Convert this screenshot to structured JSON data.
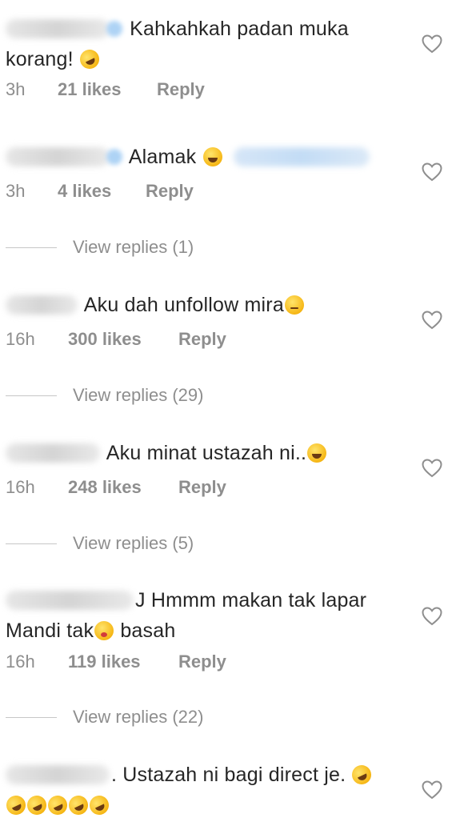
{
  "comments": [
    {
      "line1": "Kahkahkah padan muka",
      "line2": "korang!",
      "time": "3h",
      "likes": "21 likes",
      "reply": "Reply"
    },
    {
      "line1": "Alamak",
      "time": "3h",
      "likes": "4 likes",
      "reply": "Reply",
      "view_replies": "View replies (1)"
    },
    {
      "line1": "Aku dah unfollow mira",
      "time": "16h",
      "likes": "300 likes",
      "reply": "Reply",
      "view_replies": "View replies (29)"
    },
    {
      "line1": "Aku minat ustazah ni..",
      "time": "16h",
      "likes": "248 likes",
      "reply": "Reply",
      "view_replies": "View replies (5)"
    },
    {
      "line1": "J Hmmm makan tak lapar",
      "line2a": "Mandi tak",
      "line2b": " basah",
      "time": "16h",
      "likes": "119 likes",
      "reply": "Reply",
      "view_replies": "View replies (22)"
    },
    {
      "line1": ". Ustazah ni bagi direct je."
    }
  ],
  "icons": {
    "like": "heart-outline-icon",
    "laughing_rolling": "rolling-on-floor-laughing-emoji",
    "laughing_tears": "grinning-squinting-tears-emoji",
    "pensive": "pensive-face-emoji",
    "drooling": "drooling-face-emoji"
  },
  "colors": {
    "text": "#262626",
    "meta": "#8e8e8e",
    "divider": "#c7c7c7",
    "background": "#ffffff"
  }
}
